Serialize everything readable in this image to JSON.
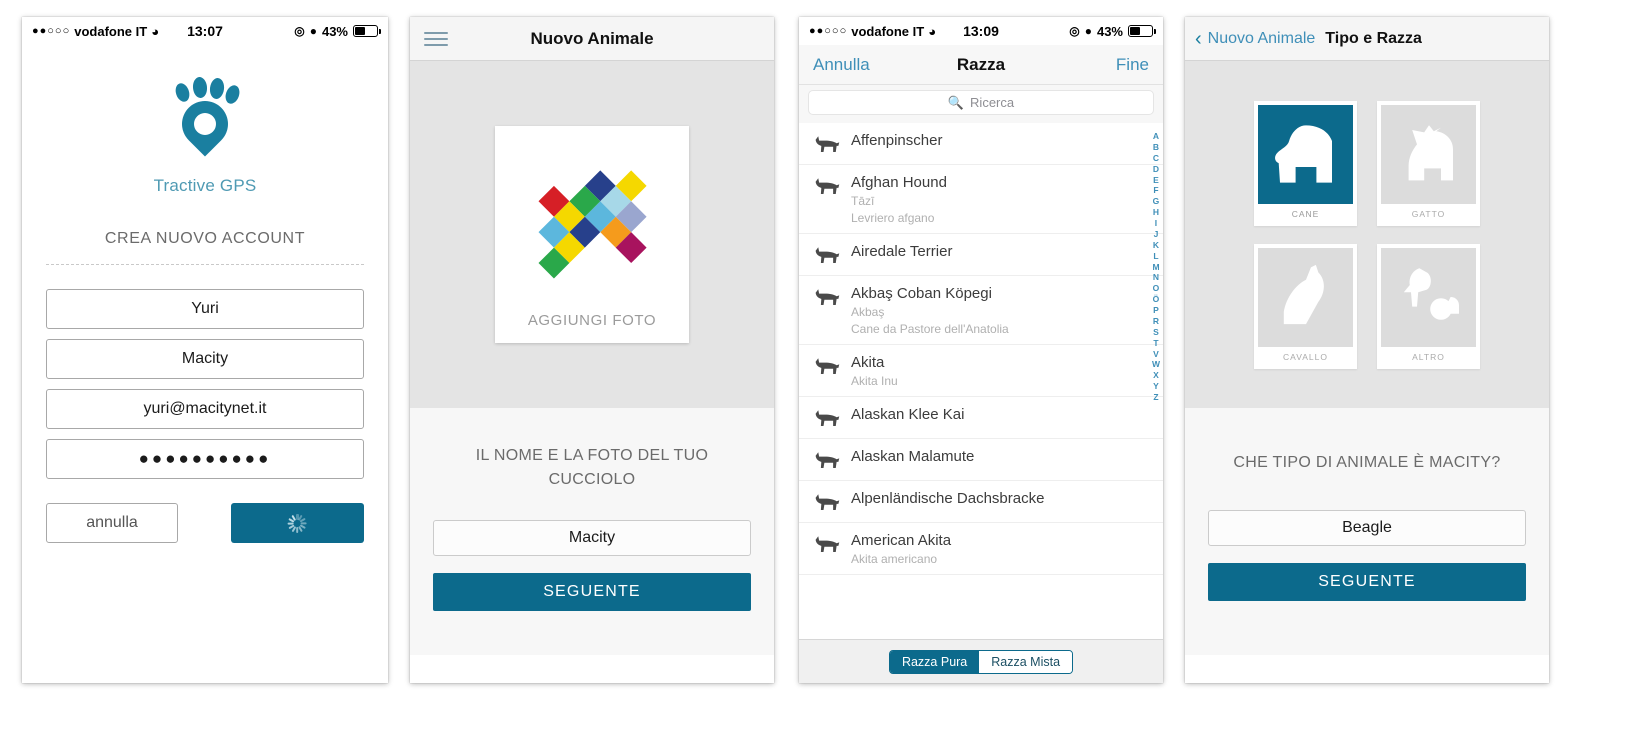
{
  "panel1": {
    "status": {
      "dots": "●●○○○",
      "carrier": "vodafone IT",
      "wifi": "▲",
      "time": "13:07",
      "location_icon": "location-icon",
      "alarm_icon": "alarm-icon",
      "battery": "43%"
    },
    "brand": "Tractive GPS",
    "logo_icon": "tractive-paw-pin-logo",
    "section_title": "CREA NUOVO ACCOUNT",
    "fields": [
      {
        "name": "first-name",
        "value": "Yuri"
      },
      {
        "name": "last-name",
        "value": "Macity"
      },
      {
        "name": "email",
        "value": "yuri@macitynet.it"
      },
      {
        "name": "password",
        "value": "●●●●●●●●●●"
      }
    ],
    "cancel_label": "annulla",
    "submit_state": "loading-spinner"
  },
  "panel2": {
    "menu_icon": "hamburger-menu-icon",
    "title": "Nuovo Animale",
    "photo_caption": "AGGIUNGI FOTO",
    "photo_logo_icon": "macitynet-mosaic-logo",
    "subtitle": "IL NOME E LA FOTO DEL TUO CUCCIOLO",
    "name_value": "Macity",
    "next_label": "SEGUENTE"
  },
  "panel3": {
    "status": {
      "dots": "●●○○○",
      "carrier": "vodafone IT",
      "wifi": "▲",
      "time": "13:09",
      "battery": "43%"
    },
    "cancel_label": "Annulla",
    "title": "Razza",
    "done_label": "Fine",
    "search_placeholder": "Ricerca",
    "search_icon": "search-icon",
    "breeds": [
      {
        "name": "Affenpinscher",
        "alt": []
      },
      {
        "name": "Afghan Hound",
        "alt": [
          "Tāzī",
          "Levriero afgano"
        ]
      },
      {
        "name": "Airedale Terrier",
        "alt": []
      },
      {
        "name": "Akbaş Coban Köpegi",
        "alt": [
          "Akbaş",
          "Cane da Pastore dell'Anatolia"
        ]
      },
      {
        "name": "Akita",
        "alt": [
          "Akita Inu"
        ]
      },
      {
        "name": "Alaskan Klee Kai",
        "alt": []
      },
      {
        "name": "Alaskan Malamute",
        "alt": []
      },
      {
        "name": "Alpenländische Dachsbracke",
        "alt": []
      },
      {
        "name": "American Akita",
        "alt": [
          "Akita americano"
        ]
      }
    ],
    "index_letters": [
      "A",
      "B",
      "C",
      "D",
      "E",
      "F",
      "G",
      "H",
      "I",
      "J",
      "K",
      "L",
      "M",
      "N",
      "O",
      "Ö",
      "P",
      "R",
      "S",
      "T",
      "V",
      "W",
      "X",
      "Y",
      "Z"
    ],
    "segmented": {
      "pure": "Razza Pura",
      "mixed": "Razza Mista",
      "selected": "Razza Pura"
    }
  },
  "panel4": {
    "back_label": "Nuovo Animale",
    "back_icon": "chevron-left-icon",
    "title": "Tipo e Razza",
    "tiles": [
      {
        "label": "CANE",
        "icon": "dog-icon",
        "selected": true
      },
      {
        "label": "GATTO",
        "icon": "cat-icon",
        "selected": false
      },
      {
        "label": "CAVALLO",
        "icon": "horse-icon",
        "selected": false
      },
      {
        "label": "ALTRO",
        "icon": "other-animals-icon",
        "selected": false
      }
    ],
    "question": "CHE TIPO DI ANIMALE È MACITY?",
    "breed_value": "Beagle",
    "next_label": "SEGUENTE"
  },
  "colors": {
    "accent": "#0c6a8c",
    "link": "#3f8fb8",
    "brand_text": "#4f9ab3",
    "panel_bg": "#e4e4e4"
  },
  "mosaic_colors": [
    "#f5d800",
    "#27408b",
    "#9aa6cf",
    "#a7d8e8",
    "#f59b1c",
    "#2aa84a",
    "#d61f26",
    "#f5d800",
    "#5cb7dd",
    "#27408b",
    "#a8135e",
    "#5cb7dd",
    "#f5d800",
    "#2aa84a"
  ]
}
